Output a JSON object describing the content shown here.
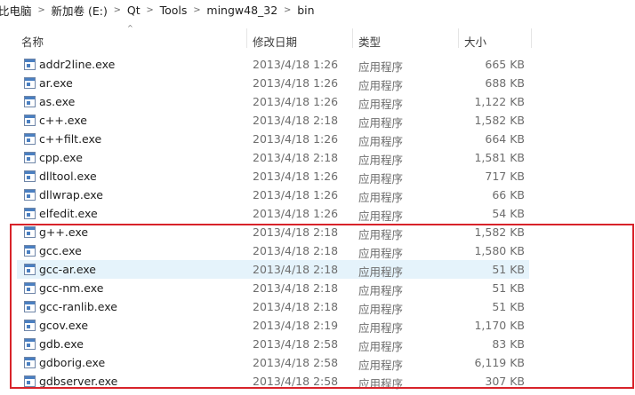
{
  "breadcrumb": [
    "比电脑",
    "新加卷 (E:)",
    "Qt",
    "Tools",
    "mingw48_32",
    "bin"
  ],
  "breadcrumb_separator": ">",
  "columns": {
    "name": "名称",
    "date": "修改日期",
    "type": "类型",
    "size": "大小"
  },
  "sort_indicator": "^",
  "files": [
    {
      "name": "addr2line.exe",
      "date": "2013/4/18 1:26",
      "type": "应用程序",
      "size": "665 KB"
    },
    {
      "name": "ar.exe",
      "date": "2013/4/18 1:26",
      "type": "应用程序",
      "size": "688 KB"
    },
    {
      "name": "as.exe",
      "date": "2013/4/18 1:26",
      "type": "应用程序",
      "size": "1,122 KB"
    },
    {
      "name": "c++.exe",
      "date": "2013/4/18 2:18",
      "type": "应用程序",
      "size": "1,582 KB"
    },
    {
      "name": "c++filt.exe",
      "date": "2013/4/18 1:26",
      "type": "应用程序",
      "size": "664 KB"
    },
    {
      "name": "cpp.exe",
      "date": "2013/4/18 2:18",
      "type": "应用程序",
      "size": "1,581 KB"
    },
    {
      "name": "dlltool.exe",
      "date": "2013/4/18 1:26",
      "type": "应用程序",
      "size": "717 KB"
    },
    {
      "name": "dllwrap.exe",
      "date": "2013/4/18 1:26",
      "type": "应用程序",
      "size": "66 KB"
    },
    {
      "name": "elfedit.exe",
      "date": "2013/4/18 1:26",
      "type": "应用程序",
      "size": "54 KB"
    },
    {
      "name": "g++.exe",
      "date": "2013/4/18 2:18",
      "type": "应用程序",
      "size": "1,582 KB"
    },
    {
      "name": "gcc.exe",
      "date": "2013/4/18 2:18",
      "type": "应用程序",
      "size": "1,580 KB"
    },
    {
      "name": "gcc-ar.exe",
      "date": "2013/4/18 2:18",
      "type": "应用程序",
      "size": "51 KB"
    },
    {
      "name": "gcc-nm.exe",
      "date": "2013/4/18 2:18",
      "type": "应用程序",
      "size": "51 KB"
    },
    {
      "name": "gcc-ranlib.exe",
      "date": "2013/4/18 2:18",
      "type": "应用程序",
      "size": "51 KB"
    },
    {
      "name": "gcov.exe",
      "date": "2013/4/18 2:19",
      "type": "应用程序",
      "size": "1,170 KB"
    },
    {
      "name": "gdb.exe",
      "date": "2013/4/18 2:58",
      "type": "应用程序",
      "size": "83 KB"
    },
    {
      "name": "gdborig.exe",
      "date": "2013/4/18 2:58",
      "type": "应用程序",
      "size": "6,119 KB"
    },
    {
      "name": "gdbserver.exe",
      "date": "2013/4/18 2:58",
      "type": "应用程序",
      "size": "307 KB"
    }
  ],
  "selected_index": 11,
  "colors": {
    "selection": "#e5f3fb",
    "highlight_box": "#d8232a",
    "icon_blue": "#4a7fc1"
  }
}
